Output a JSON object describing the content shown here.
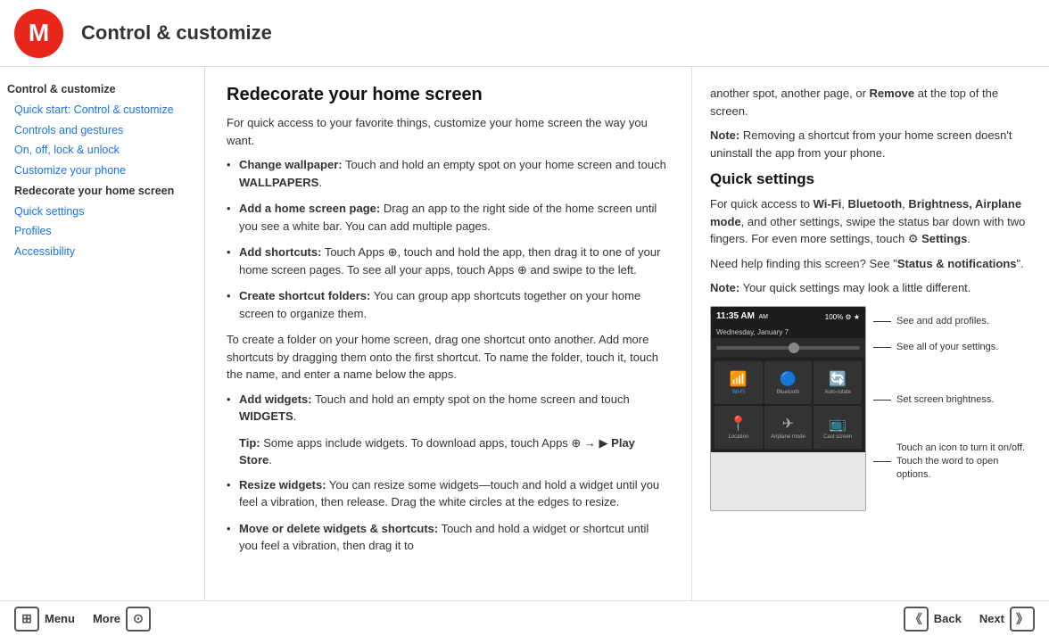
{
  "header": {
    "title": "Control & customize"
  },
  "sidebar": {
    "items": [
      {
        "id": "control-customize",
        "label": "Control & customize",
        "type": "main"
      },
      {
        "id": "quick-start",
        "label": "Quick start: Control & customize",
        "type": "sub"
      },
      {
        "id": "controls-gestures",
        "label": "Controls and gestures",
        "type": "sub"
      },
      {
        "id": "on-off-lock",
        "label": "On, off, lock & unlock",
        "type": "sub"
      },
      {
        "id": "customize-phone",
        "label": "Customize your phone",
        "type": "sub"
      },
      {
        "id": "redecorate",
        "label": "Redecorate your home screen",
        "type": "sub",
        "active": true
      },
      {
        "id": "quick-settings",
        "label": "Quick settings",
        "type": "sub"
      },
      {
        "id": "profiles",
        "label": "Profiles",
        "type": "sub"
      },
      {
        "id": "accessibility",
        "label": "Accessibility",
        "type": "sub"
      }
    ]
  },
  "main": {
    "left": {
      "heading": "Redecorate your home screen",
      "intro": "For quick access to your favorite things, customize your home screen the way you want.",
      "items": [
        {
          "bold": "Change wallpaper:",
          "text": " Touch and hold an empty spot on your home screen and touch WALLPAPERS."
        },
        {
          "bold": "Add a home screen page:",
          "text": " Drag an app to the right side of the home screen until you see a white bar. You can add multiple pages."
        },
        {
          "bold": "Add shortcuts:",
          "text": " Touch Apps ⊕, touch and hold the app, then drag it to one of your home screen pages. To see all your apps, touch Apps ⊕ and swipe to the left."
        },
        {
          "bold": "Create shortcut folders:",
          "text": " You can group app shortcuts together on your home screen to organize them."
        }
      ],
      "folder_paragraph": "To create a folder on your home screen, drag one shortcut onto another. Add more shortcuts by dragging them onto the first shortcut. To name the folder, touch it, touch the name, and enter a name below the apps.",
      "items2": [
        {
          "bold": "Add widgets:",
          "text": " Touch and hold an empty spot on the home screen and touch WIDGETS."
        }
      ],
      "tip_bold": "Tip:",
      "tip_text": " Some apps include widgets. To download apps, touch Apps ⊕ → ▶ Play Store.",
      "items3": [
        {
          "bold": "Resize widgets:",
          "text": " You can resize some widgets—touch and hold a widget until you feel a vibration, then release. Drag the white circles at the edges to resize."
        },
        {
          "bold": "Move or delete widgets & shortcuts:",
          "text": " Touch and hold a widget or shortcut until you feel a vibration, then drag it to"
        }
      ]
    },
    "right": {
      "continued_text": "another spot, another page, or Remove at the top of the screen.",
      "note1_bold": "Note:",
      "note1_text": " Removing a shortcut from your home screen doesn't uninstall the app from your phone.",
      "quick_settings_heading": "Quick settings",
      "qs_intro": "For quick access to Wi-Fi, Bluetooth, Brightness, Airplane mode, and other settings, swipe the status bar down with two fingers. For even more settings, touch ⚙ Settings.",
      "qs_help": "Need help finding this screen? See \"Status & notifications\".",
      "note2_bold": "Note:",
      "note2_text": " Your quick settings may look a little different.",
      "callouts": [
        "See and add profiles.",
        "See all of your settings.",
        "Set screen brightness.",
        "Touch an icon to turn it on/off.\nTouch the word to open options."
      ],
      "phone_tiles": [
        {
          "icon": "📶",
          "label": "Wi-Fi",
          "active": true
        },
        {
          "icon": "✈",
          "label": "Airplane mode",
          "active": false
        },
        {
          "icon": "🔄",
          "label": "Auto-rotate",
          "active": false
        },
        {
          "icon": "📍",
          "label": "Location",
          "active": false
        },
        {
          "icon": "📺",
          "label": "Cast screen",
          "active": false
        }
      ],
      "phone_time": "11:35 AM",
      "phone_date": "Wednesday, January 7",
      "phone_battery": "100%"
    }
  },
  "footer": {
    "menu_label": "Menu",
    "more_label": "More",
    "back_label": "Back",
    "next_label": "Next",
    "menu_icon": "⊞",
    "back_icon": "《",
    "more_icon": "⊙",
    "next_icon": "》"
  }
}
